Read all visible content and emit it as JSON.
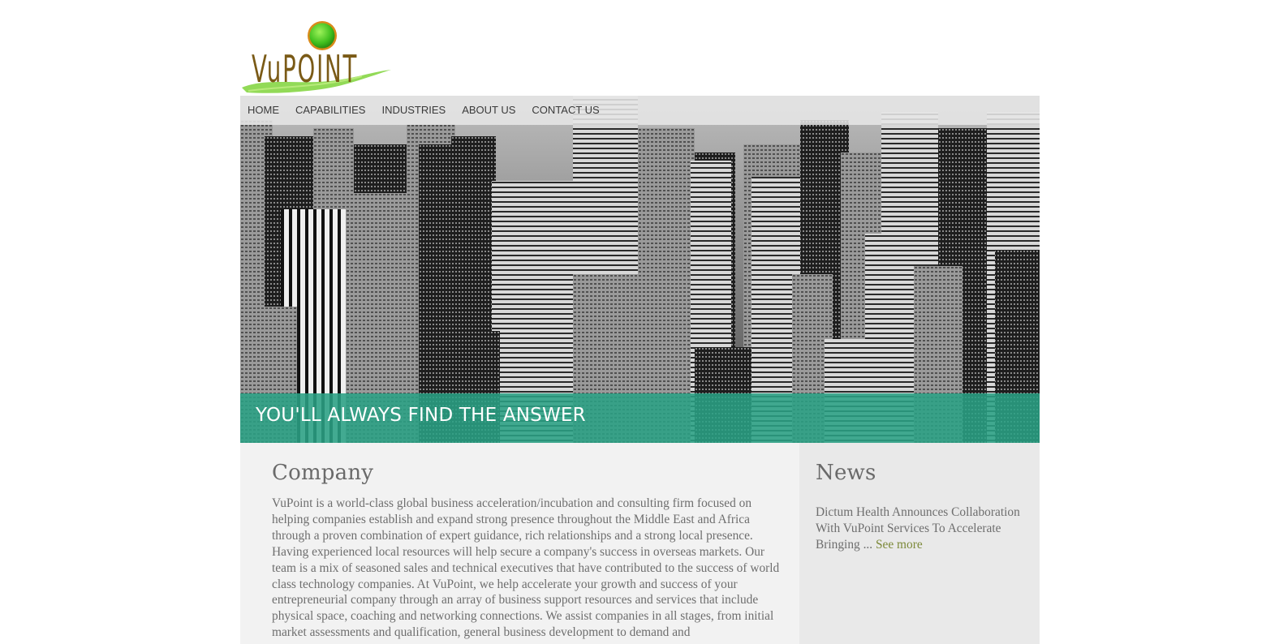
{
  "logo": {
    "text": "VuPOINT",
    "accent_colors": [
      "#5fcf2a",
      "#c27a12",
      "#8fd64a"
    ]
  },
  "nav": {
    "items": [
      {
        "label": "HOME"
      },
      {
        "label": "CAPABILITIES"
      },
      {
        "label": "INDUSTRIES"
      },
      {
        "label": "ABOUT US"
      },
      {
        "label": "CONTACT US"
      }
    ]
  },
  "hero": {
    "image_description_icon": "city-skyline-image",
    "banner_text": "YOU'LL ALWAYS FIND THE ANSWER",
    "banner_color": "#2aa084"
  },
  "company": {
    "title": "Company",
    "body": "VuPoint is a world-class global business acceleration/incubation and consulting firm focused on helping companies establish and expand strong presence throughout the Middle East and Africa through a proven combination of expert guidance, rich relationships and a strong local presence. Having experienced local resources will help secure a company's success in overseas markets. Our team is a mix of seasoned sales and technical executives that have contributed to the success of world class technology companies. At VuPoint, we help accelerate your growth and success of your entrepreneurial company through an array of business support resources and services that include physical space, coaching and networking connections. We assist companies in all stages, from initial market assessments and qualification, general business development to demand and"
  },
  "news": {
    "title": "News",
    "item_text": "Dictum Health Announces Collaboration With VuPoint Services To Accelerate Bringing ... ",
    "see_more": "See more"
  }
}
